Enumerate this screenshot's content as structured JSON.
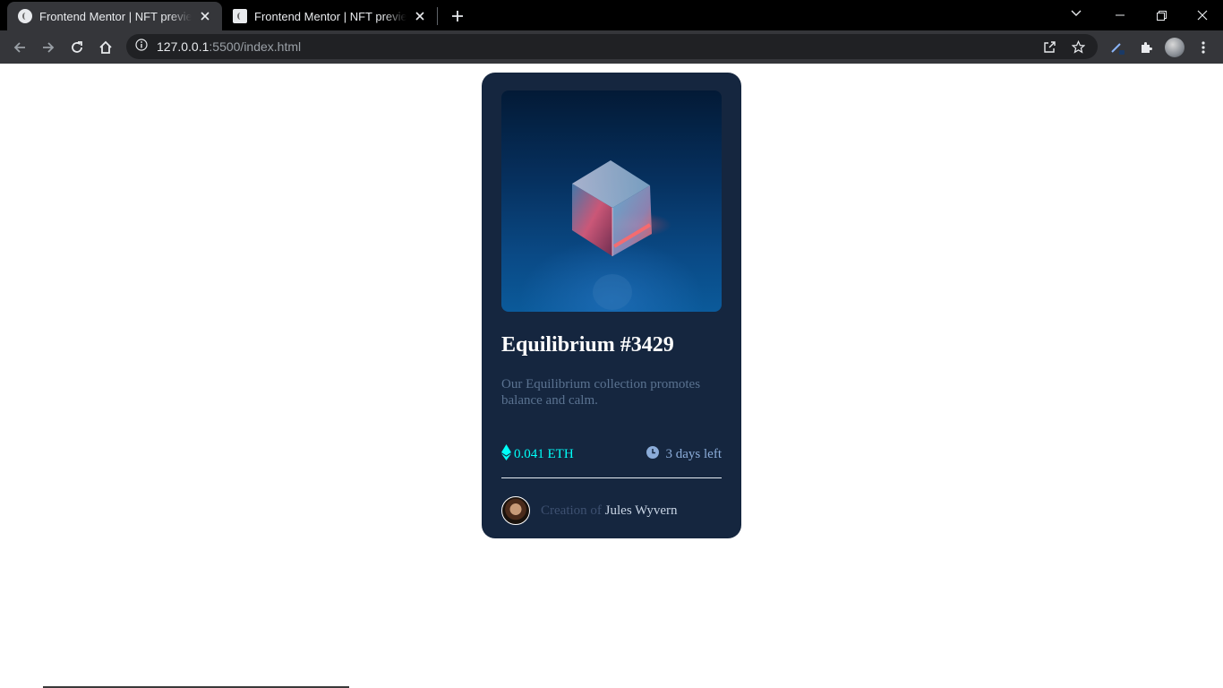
{
  "browser": {
    "tabs": [
      {
        "title": "Frontend Mentor | NFT preview card component",
        "active": true
      },
      {
        "title": "Frontend Mentor | NFT preview card component",
        "active": false
      }
    ],
    "url_host": "127.0.0.1",
    "url_rest": ":5500/index.html"
  },
  "card": {
    "title": "Equilibrium #3429",
    "description": "Our Equilibrium collection promotes balance and calm.",
    "price": "0.041 ETH",
    "time_left": "3 days left",
    "creator_prefix": "Creation of",
    "creator_name": "Jules Wyvern",
    "image_icon": "nft-cube-image"
  },
  "colors": {
    "card_bg": "#15263f",
    "accent_cyan": "#00fff8",
    "soft_blue": "#8bacd9",
    "page_bg": "#ffffff"
  }
}
